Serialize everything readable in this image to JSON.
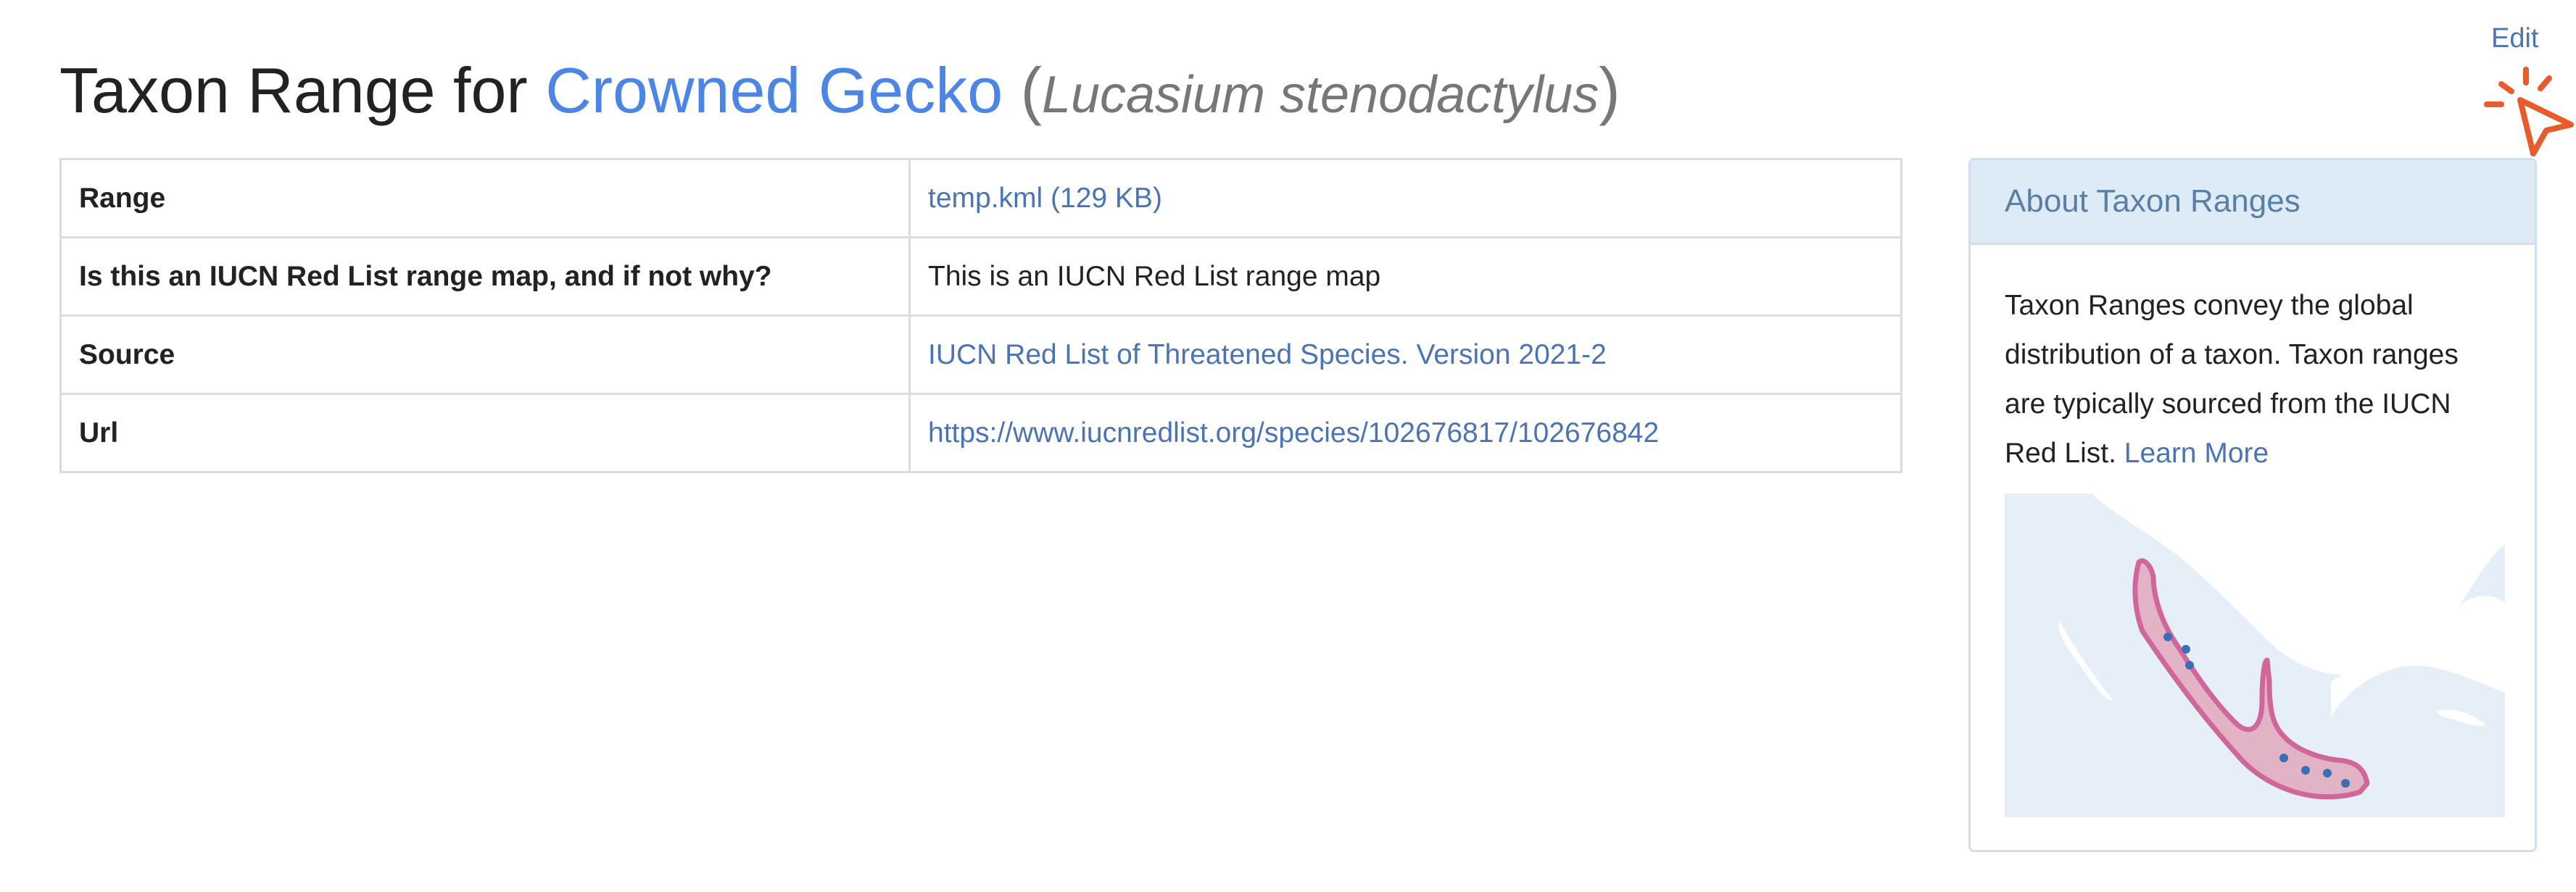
{
  "header": {
    "edit_label": "Edit",
    "title_prefix": "Taxon Range for ",
    "common_name": "Crowned Gecko",
    "paren_open": " (",
    "scientific_name": "Lucasium stenodactylus",
    "paren_close": ")"
  },
  "range_table": {
    "rows": [
      {
        "label": "Range",
        "value": "temp.kml (129 KB)",
        "is_link": true
      },
      {
        "label": "Is this an IUCN Red List range map, and if not why?",
        "value": "This is an IUCN Red List range map",
        "is_link": false
      },
      {
        "label": "Source",
        "value": "IUCN Red List of Threatened Species. Version 2021-2",
        "is_link": true
      },
      {
        "label": "Url",
        "value": "https://www.iucnredlist.org/species/102676817/102676842",
        "is_link": true
      }
    ]
  },
  "about_panel": {
    "title": "About Taxon Ranges",
    "description": "Taxon Ranges convey the global distribution of a taxon. Taxon ranges are typically sourced from the IUCN Red List.",
    "learn_more_label": "Learn More"
  },
  "colors": {
    "link": "#4a74b6",
    "title_link": "#4b86e6",
    "panel_header_bg": "#dcebf5",
    "range_fill": "#e2b3c4",
    "range_stroke": "#d0679a",
    "cursor_accent": "#e85c2c"
  },
  "icons": [
    "cursor-pointer-icon"
  ]
}
